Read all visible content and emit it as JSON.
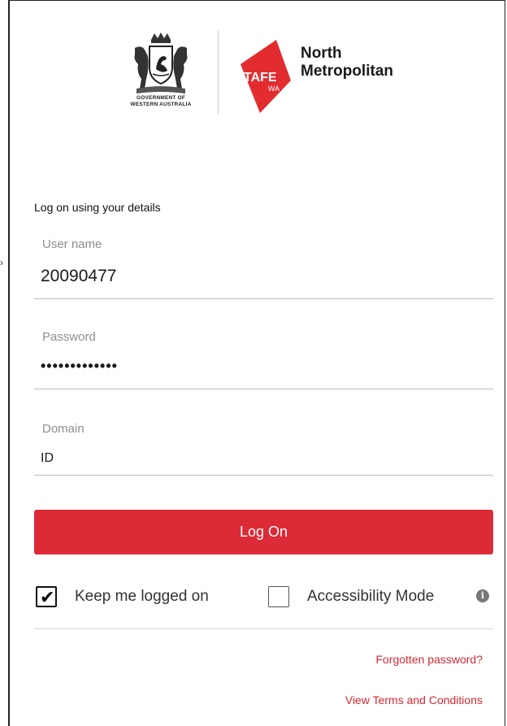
{
  "branding": {
    "gov_line1": "GOVERNMENT OF",
    "gov_line2": "WESTERN AUSTRALIA",
    "tafe_badge": "TAFE",
    "tafe_badge_sub": "WA",
    "org_line1": "North",
    "org_line2": "Metropolitan",
    "accent_color": "#dc2b36"
  },
  "form": {
    "heading": "Log on using your details",
    "username": {
      "label": "User name",
      "value": "20090477"
    },
    "password": {
      "label": "Password",
      "value": "•••••••••••••"
    },
    "domain": {
      "label": "Domain",
      "value": "ID"
    },
    "submit_label": "Log On",
    "keep_logged_on": {
      "label": "Keep me logged on",
      "checked": true
    },
    "accessibility_mode": {
      "label": "Accessibility Mode",
      "checked": false,
      "info_icon": "info-icon"
    }
  },
  "links": {
    "forgot_password": "Forgotten password?",
    "terms": "View Terms and Conditions"
  }
}
